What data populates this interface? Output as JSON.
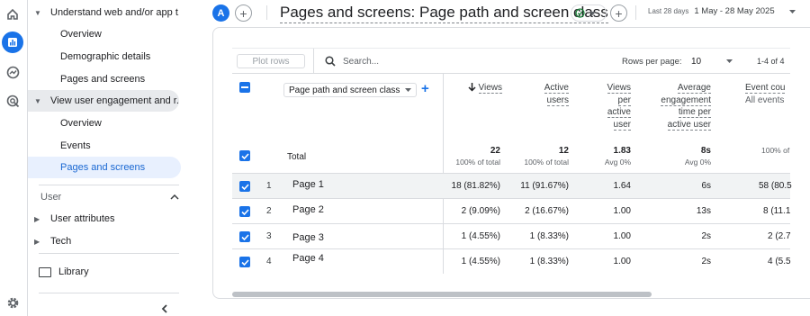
{
  "rail": {
    "icons": [
      "home-icon",
      "reports-icon",
      "explore-icon",
      "advertising-icon",
      "settings-icon"
    ]
  },
  "sidebar": {
    "sections": [
      {
        "label": "Understand web and/or app t...",
        "expanded": true
      },
      {
        "label": "View user engagement and r...",
        "expanded": true
      }
    ],
    "understand_items": [
      "Overview",
      "Demographic details",
      "Pages and screens"
    ],
    "engagement_items": [
      "Overview",
      "Events",
      "Pages and screens"
    ],
    "user_header": "User",
    "user_items": [
      "User attributes",
      "Tech"
    ],
    "library": "Library"
  },
  "header": {
    "avatar_letter": "A",
    "title": "Pages and screens: Page path and screen class",
    "date_prefix": "Last 28 days",
    "date_range": "1 May - 28 May 2025"
  },
  "table": {
    "plot_rows": "Plot rows",
    "search_placeholder": "Search...",
    "rows_per_page_label": "Rows per page:",
    "rows_per_page": "10",
    "pagination": "1-4 of 4",
    "dimension": "Page path and screen class",
    "columns": [
      {
        "label_lines": [
          "Views"
        ],
        "sub": "",
        "sorted": true
      },
      {
        "label_lines": [
          "Active",
          "users"
        ],
        "sub": ""
      },
      {
        "label_lines": [
          "Views",
          "per",
          "active",
          "user"
        ],
        "sub": ""
      },
      {
        "label_lines": [
          "Average",
          "engagement",
          "time per",
          "active user"
        ],
        "sub": ""
      },
      {
        "label_lines": [
          "Event cou"
        ],
        "sub": "All events"
      }
    ],
    "total_label": "Total",
    "totals": [
      {
        "value": "22",
        "pct": "100% of total"
      },
      {
        "value": "12",
        "pct": "100% of total"
      },
      {
        "value": "1.83",
        "pct": "Avg 0%"
      },
      {
        "value": "8s",
        "pct": "Avg 0%"
      },
      {
        "value": "",
        "pct": "100% of"
      }
    ],
    "rows": [
      {
        "index": "1",
        "name": "Page 1",
        "values": [
          "18 (81.82%)",
          "11 (91.67%)",
          "1.64",
          "6s",
          "58 (80.5"
        ]
      },
      {
        "index": "2",
        "name": "Page 2",
        "values": [
          "2 (9.09%)",
          "2 (16.67%)",
          "1.00",
          "13s",
          "8 (11.1"
        ]
      },
      {
        "index": "3",
        "name": "Page 3",
        "values": [
          "1 (4.55%)",
          "1 (8.33%)",
          "1.00",
          "2s",
          "2 (2.7"
        ]
      },
      {
        "index": "4",
        "name": "Page 4",
        "values": [
          "1 (4.55%)",
          "1 (8.33%)",
          "1.00",
          "2s",
          "4 (5.5"
        ]
      }
    ]
  }
}
